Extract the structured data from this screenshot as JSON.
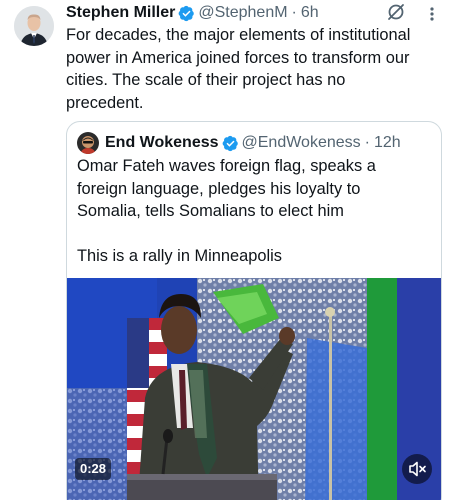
{
  "author": {
    "name": "Stephen Miller",
    "handle": "@StephenM",
    "time": "6h",
    "avatar_icon": "profile-photo"
  },
  "tweet": {
    "lines": [
      "For decades, the major elements of institutional",
      "power in America joined forces to transform our",
      "cities. The scale of their project has no",
      "precedent."
    ]
  },
  "quoted": {
    "name": "End Wokeness",
    "handle": "@EndWokeness",
    "time": "12h",
    "lines": [
      "Omar Fateh waves foreign flag, speaks a",
      "foreign language, pledges his loyalty to",
      "Somalia, tells Somalians to elect him"
    ],
    "lines2": [
      "This is a rally in Minneapolis"
    ],
    "media": {
      "duration": "0:28",
      "mute_icon": "speaker-muted-icon"
    }
  },
  "dot": "·",
  "colors": {
    "verified": "#1d9bf0",
    "secondary_text": "#536471",
    "border": "#cfd9de"
  }
}
